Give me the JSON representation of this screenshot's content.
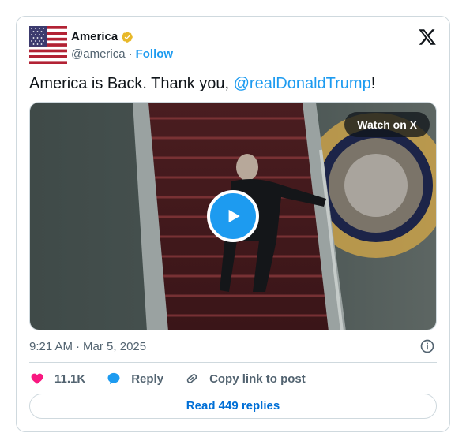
{
  "author": {
    "name": "America",
    "handle": "@america",
    "separator": "·",
    "follow_label": "Follow",
    "verified_color": "#e8b829",
    "avatar": "us-flag"
  },
  "tweet": {
    "text_before": "America is Back. Thank you, ",
    "mention": "@realDonaldTrump",
    "text_after": "!"
  },
  "media": {
    "watch_label": "Watch on X",
    "play_icon": "play-icon"
  },
  "meta": {
    "time": "9:21 AM",
    "separator": "·",
    "date": "Mar 5, 2025"
  },
  "actions": {
    "likes": "11.1K",
    "reply_label": "Reply",
    "copy_link_label": "Copy link to post"
  },
  "read_replies_label": "Read 449 replies",
  "colors": {
    "accent": "#1d9bf0",
    "like": "#f91880",
    "link": "#006fd6",
    "muted": "#536471"
  }
}
